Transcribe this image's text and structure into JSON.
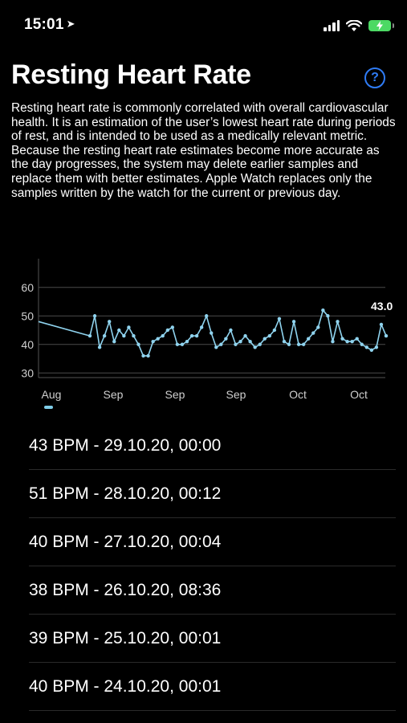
{
  "status_bar": {
    "time": "15:01"
  },
  "header": {
    "title": "Resting Heart Rate",
    "help_label": "?"
  },
  "description": "Resting heart rate is commonly correlated with overall cardiovascular health. It is an estimation of the user’s lowest heart rate during periods of rest, and is intended to be used as a medically relevant metric. Because the resting heart rate estimates become more accurate as the day progresses, the system may delete earlier samples and replace them with better estimates. Apple Watch replaces only the samples written by the watch for the current or previous day.",
  "chart_data": {
    "type": "line",
    "y_ticks": [
      "60",
      "50",
      "40",
      "30"
    ],
    "ylim": [
      25,
      65
    ],
    "x_ticks": [
      "Aug",
      "Sep",
      "Sep",
      "Sep",
      "Oct",
      "Oct"
    ],
    "latest_value_label": "43.0",
    "grid": true,
    "series": [
      {
        "color": "#8fd3ee",
        "values": [
          48,
          43,
          50,
          39,
          43,
          48,
          41,
          45,
          43,
          46,
          43,
          40,
          36,
          36,
          41,
          42,
          43,
          45,
          46,
          40,
          40,
          41,
          43,
          43,
          46,
          50,
          44,
          39,
          40,
          42,
          45,
          40,
          41,
          43,
          41,
          39,
          40,
          42,
          43,
          45,
          49,
          41,
          40,
          48,
          40,
          40,
          42,
          44,
          46,
          52,
          50,
          41,
          48,
          42,
          41,
          41,
          42,
          40,
          39,
          38,
          39,
          47,
          43
        ]
      }
    ]
  },
  "samples": [
    {
      "label": "43 BPM - 29.10.20, 00:00"
    },
    {
      "label": "51 BPM - 28.10.20, 00:12"
    },
    {
      "label": "40 BPM - 27.10.20, 00:04"
    },
    {
      "label": "38 BPM - 26.10.20, 08:36"
    },
    {
      "label": "39 BPM - 25.10.20, 00:01"
    },
    {
      "label": "40 BPM - 24.10.20, 00:01"
    }
  ]
}
